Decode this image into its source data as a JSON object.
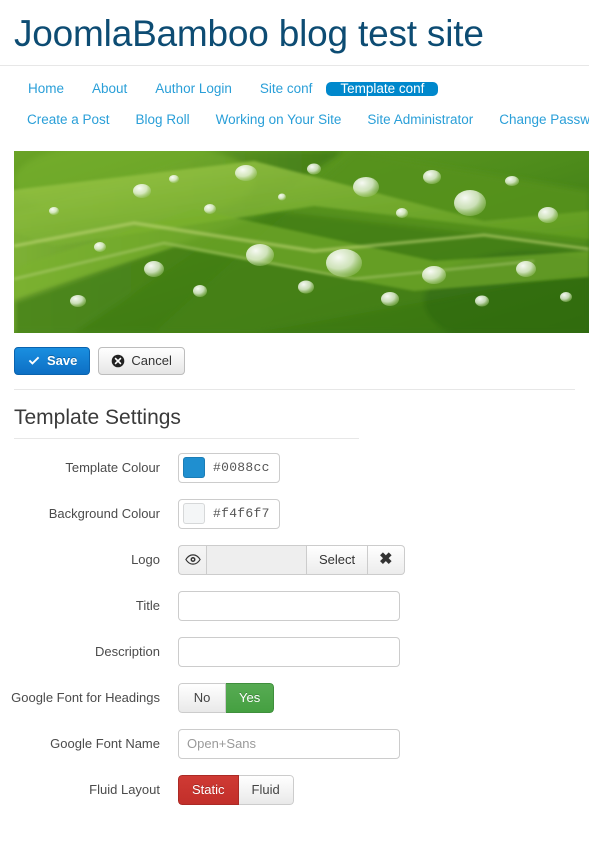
{
  "header": {
    "site_title": "JoomlaBamboo blog test site"
  },
  "nav": {
    "row1": [
      {
        "label": "Home",
        "active": false
      },
      {
        "label": "About",
        "active": false
      },
      {
        "label": "Author Login",
        "active": false
      },
      {
        "label": "Site conf",
        "active": false
      },
      {
        "label": "Template conf",
        "active": true
      }
    ],
    "row2": [
      {
        "label": "Create a Post"
      },
      {
        "label": "Blog Roll"
      },
      {
        "label": "Working on Your Site"
      },
      {
        "label": "Site Administrator"
      },
      {
        "label": "Change Password"
      }
    ]
  },
  "hero": {
    "alt": "green leaves with water droplets"
  },
  "toolbar": {
    "save_label": "Save",
    "cancel_label": "Cancel"
  },
  "section": {
    "title": "Template Settings"
  },
  "form": {
    "template_colour": {
      "label": "Template Colour",
      "value": "#0088cc",
      "swatch": "#1f8fd0"
    },
    "background_colour": {
      "label": "Background Colour",
      "value": "#f4f6f7",
      "swatch": "#f4f6f7"
    },
    "logo": {
      "label": "Logo",
      "value": "",
      "select_label": "Select",
      "clear_label": "✖"
    },
    "title": {
      "label": "Title",
      "value": "",
      "placeholder": ""
    },
    "description": {
      "label": "Description",
      "value": "",
      "placeholder": ""
    },
    "google_font_headings": {
      "label": "Google Font for Headings",
      "options": [
        "No",
        "Yes"
      ],
      "selected": "Yes"
    },
    "google_font_name": {
      "label": "Google Font Name",
      "value": "Open+Sans",
      "placeholder": "Open+Sans"
    },
    "fluid_layout": {
      "label": "Fluid Layout",
      "options": [
        "Static",
        "Fluid"
      ],
      "selected": "Static"
    }
  },
  "colors": {
    "brand": "#0088cc",
    "link": "#2a9fd8",
    "heading": "#0d4c73",
    "success": "#45a041",
    "danger": "#c22f2a"
  }
}
